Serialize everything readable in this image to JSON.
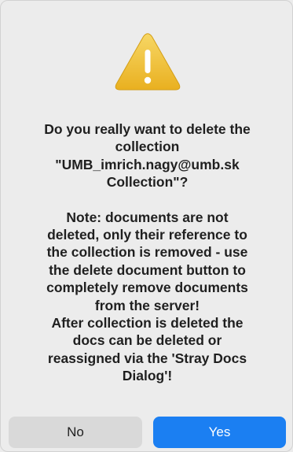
{
  "dialog": {
    "icon": "warning-triangle-icon",
    "question_lines": [
      "Do you really want to delete the",
      "collection",
      "\"UMB_imrich.nagy@umb.sk",
      "Collection\"?"
    ],
    "note_lines": [
      "Note: documents are not",
      "deleted, only their reference to",
      "the collection is removed - use",
      "the delete document button to",
      "completely remove documents",
      "from the server!",
      "After collection is deleted the",
      "docs can be deleted or",
      "reassigned via the 'Stray Docs",
      "Dialog'!"
    ],
    "buttons": {
      "no_label": "No",
      "yes_label": "Yes"
    }
  },
  "colors": {
    "background": "#ececec",
    "accent": "#1b7ff2",
    "warning": "#f0be2c"
  }
}
